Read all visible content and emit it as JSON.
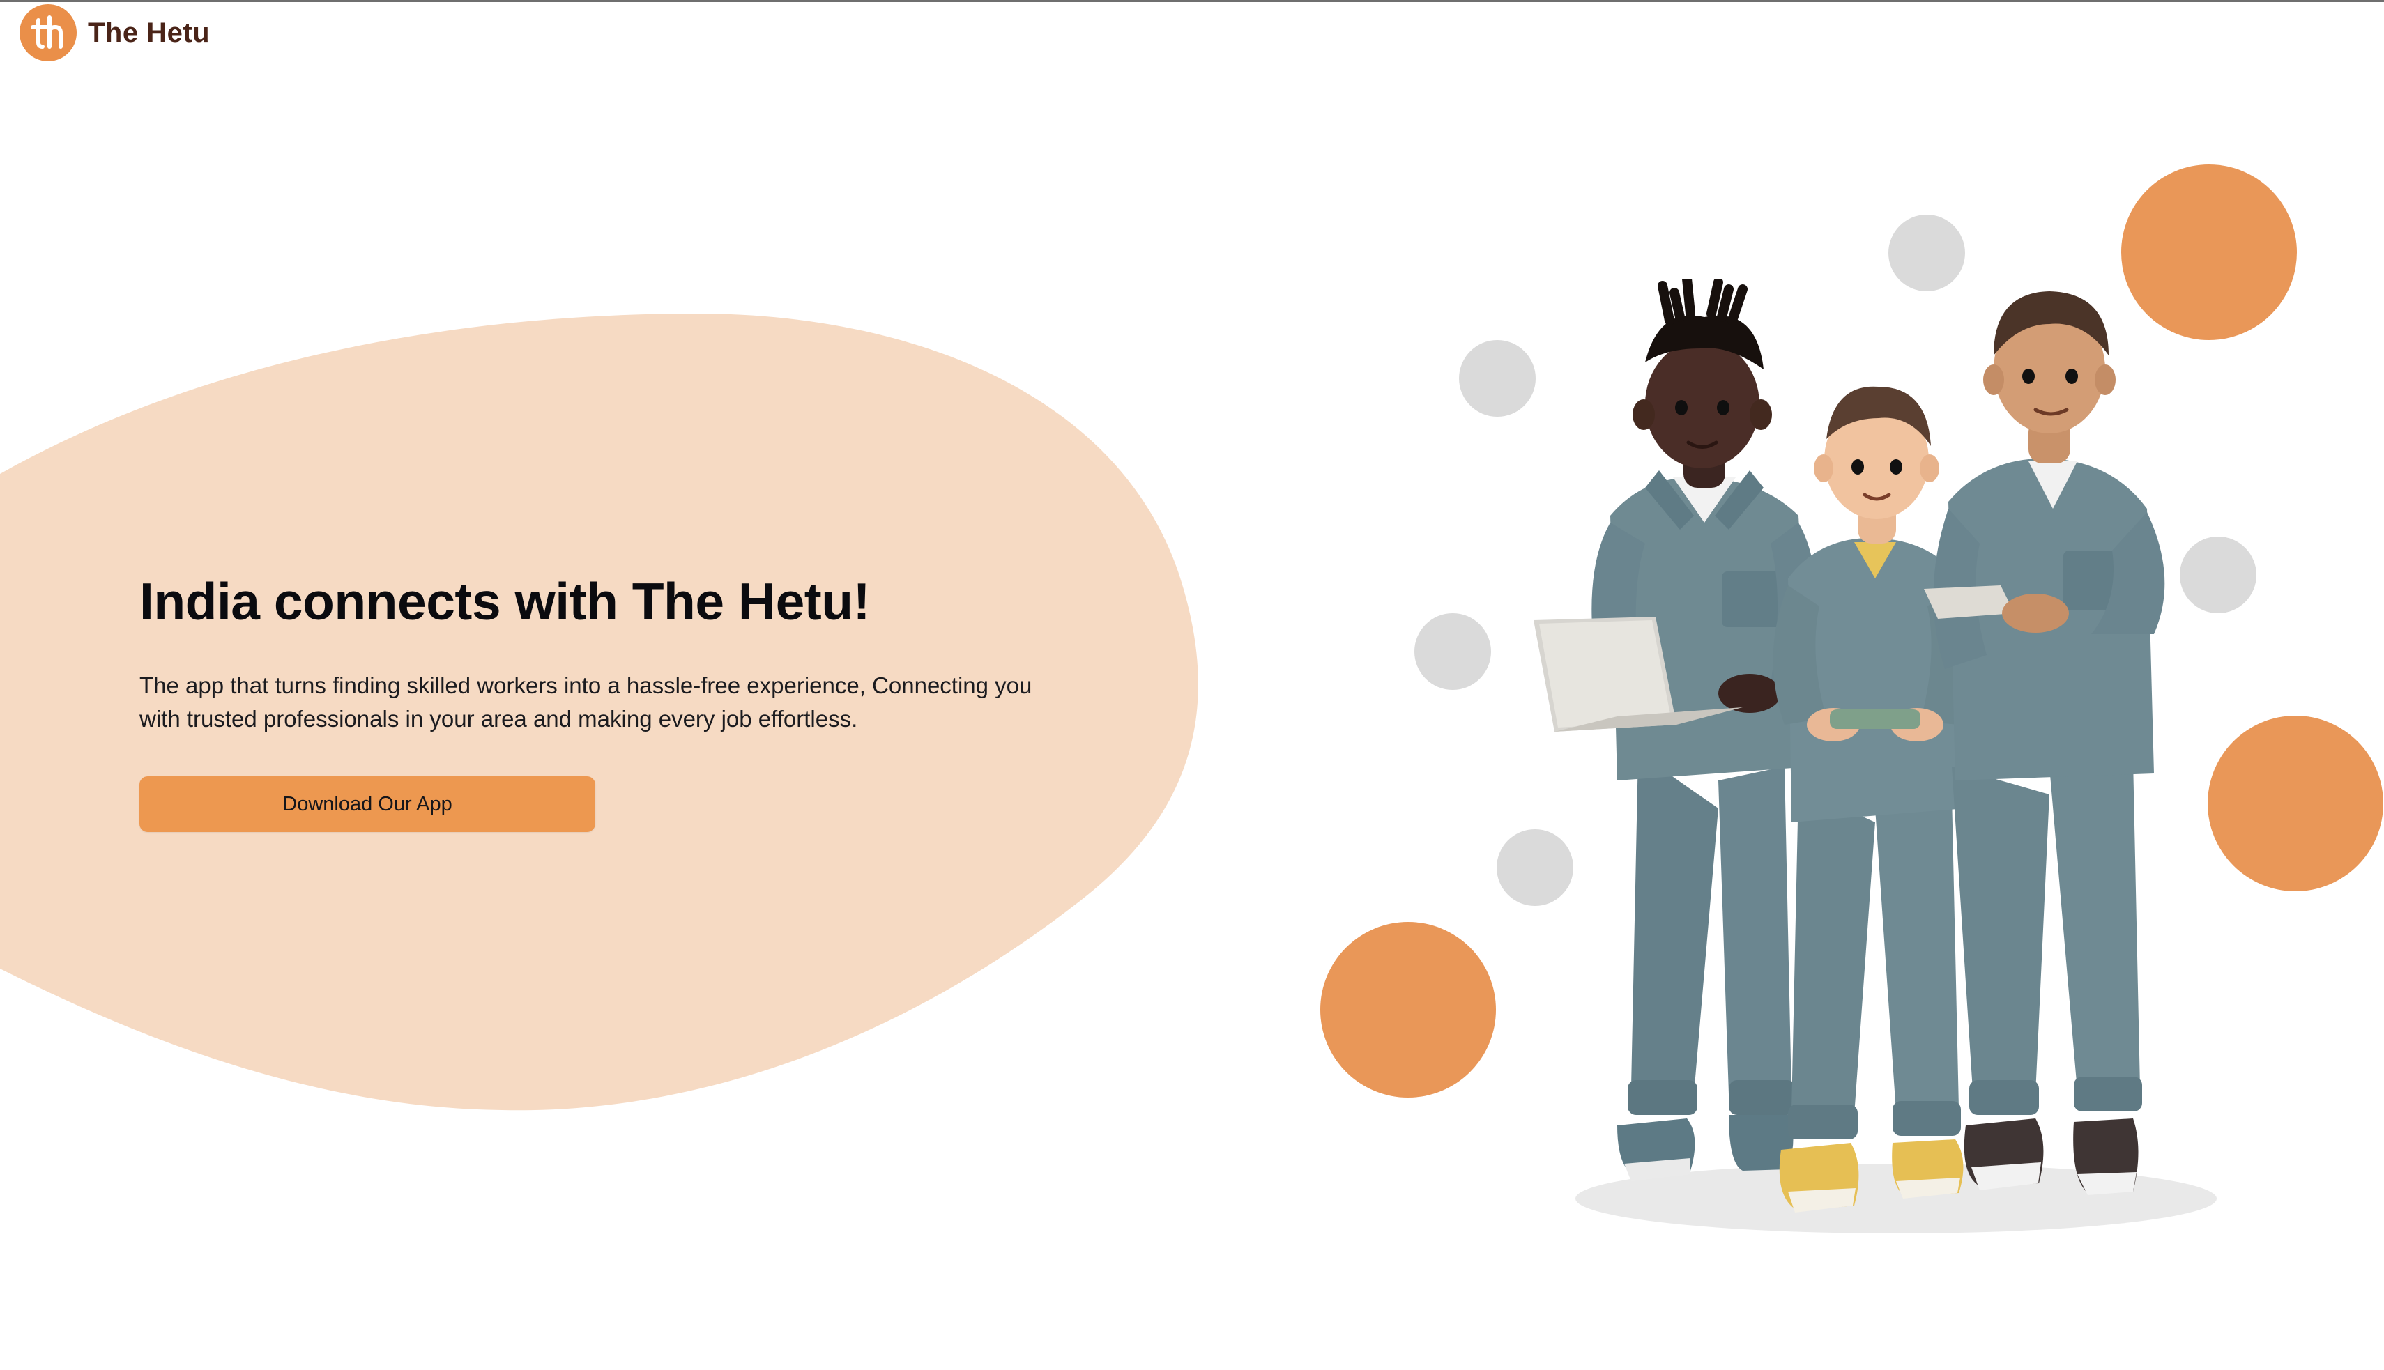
{
  "brand": {
    "name": "The Hetu",
    "logo_icon": "hetu-th-monogram-icon",
    "colors": {
      "mark": "#ea8f49",
      "text": "#4a2418"
    }
  },
  "hero": {
    "title": "India connects with The Hetu!",
    "description": "The app that turns finding skilled workers into a hassle-free experience, Connecting you with trusted professionals in your area and making every job effortless.",
    "cta_label": "Download Our App"
  },
  "illustration": {
    "icon": "three-workers-illustration"
  },
  "colors": {
    "accent": "#ed9850",
    "blob": "#f6dac3",
    "decor_orange": "#e99758",
    "decor_gray": "#dadada",
    "jumpsuit": "#6f8a92"
  }
}
